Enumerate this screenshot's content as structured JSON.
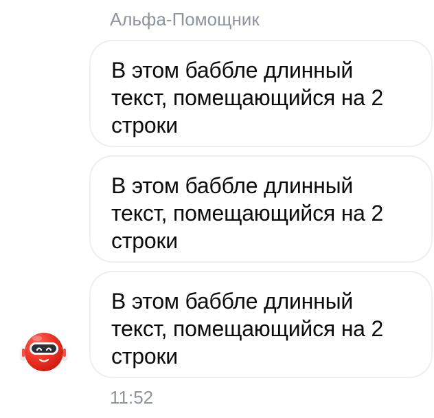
{
  "chat": {
    "sender_name": "Альфа-Помощник",
    "messages": [
      {
        "text": "В этом баббле длинный текст, помещающийся на 2 строки"
      },
      {
        "text": "В этом баббле длинный текст, помещающийся на 2 строки"
      },
      {
        "text": "В этом баббле длинный текст, помещающийся на 2 строки"
      }
    ],
    "timestamp": "11:52",
    "avatar_icon": "robot-assistant-icon"
  },
  "colors": {
    "background": "#ffffff",
    "bubble_border": "#eceef1",
    "meta_text": "#8f949b",
    "message_text": "#0b0b0b",
    "avatar_red": "#ef3124"
  }
}
